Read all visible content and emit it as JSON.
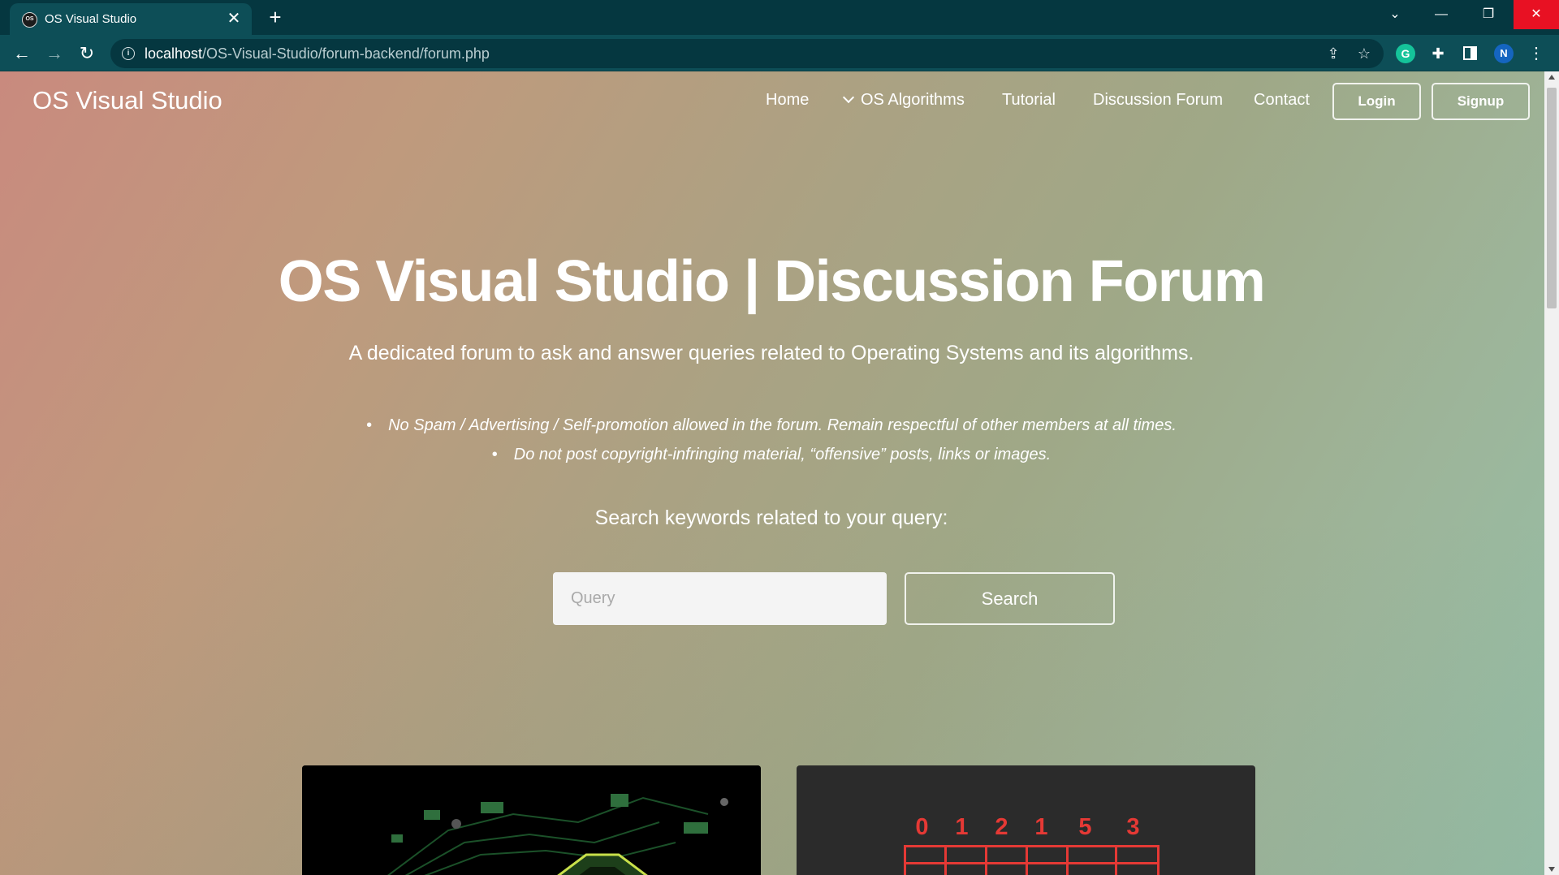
{
  "browser": {
    "tab_title": "OS Visual Studio",
    "tab_favicon_text": "OS",
    "tab_close_glyph": "✕",
    "new_tab_glyph": "+",
    "url_host": "localhost",
    "url_path": "/OS-Visual-Studio/forum-backend/forum.php",
    "profile_initial": "N",
    "extension_initial": "G",
    "icons": [
      "back-arrow-icon",
      "forward-arrow-icon",
      "reload-icon",
      "info-icon",
      "share-icon",
      "star-icon",
      "grammarly-icon",
      "puzzle-icon",
      "side-panel-icon",
      "kebab-menu-icon"
    ]
  },
  "navbar": {
    "brand": "OS Visual Studio",
    "links": {
      "home": "Home",
      "algorithms": "OS Algorithms",
      "tutorial": "Tutorial",
      "forum": "Discussion Forum",
      "contact": "Contact"
    },
    "login_label": "Login",
    "signup_label": "Signup"
  },
  "hero": {
    "title": "OS Visual Studio | Discussion Forum",
    "subtitle": "A dedicated forum to ask and answer queries related to Operating Systems and its algorithms.",
    "rules": [
      "No Spam / Advertising / Self-promotion allowed in the forum. Remain respectful of other members at all times.",
      "Do not post copyright-infringing material, “offensive” posts, links or images."
    ],
    "search_label": "Search keywords related to your query:",
    "search_placeholder": "Query",
    "search_button": "Search"
  },
  "cards": {
    "page_reference_string": [
      "0",
      "1",
      "2",
      "1",
      "5",
      "3"
    ],
    "accent_color": "#e53935"
  },
  "colors": {
    "chrome_dark": "#053740",
    "chrome_toolbar": "#0d4e57",
    "close_red": "#e81123"
  }
}
